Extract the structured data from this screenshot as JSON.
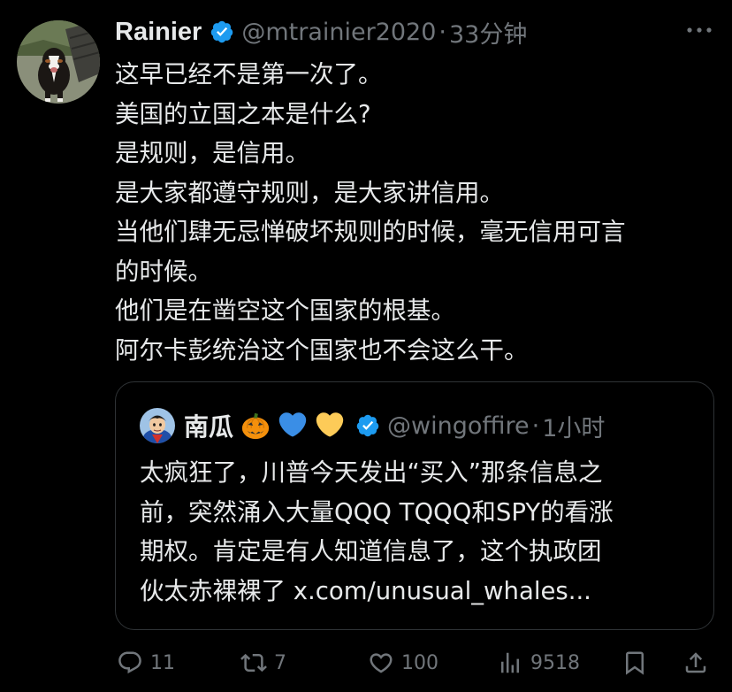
{
  "tweet": {
    "author": {
      "display_name": "Rainier",
      "handle": "@mtrainier2020",
      "separator": "·",
      "time": "33分钟"
    },
    "text_lines": [
      "这早已经不是第一次了。",
      "美国的立国之本是什么?",
      "是规则，是信用。",
      "是大家都遵守规则，是大家讲信用。",
      "当他们肆无忌惮破坏规则的时候，毫无信用可言",
      "的时候。",
      "他们是在凿空这个国家的根基。",
      "阿尔卡彭统治这个国家也不会这么干。"
    ]
  },
  "quote": {
    "author": {
      "display_name": "南瓜",
      "emojis": [
        "jack-o-lantern-icon",
        "blue-heart-icon",
        "yellow-heart-icon"
      ],
      "handle": "@wingoffire",
      "separator": "·",
      "time": "1小时"
    },
    "text_lines": [
      "太疯狂了，川普今天发出“买入”那条信息之",
      "前，突然涌入大量QQQ TQQQ和SPY的看涨",
      "期权。肯定是有人知道信息了，这个执政团",
      "伙太赤裸裸了 x.com/unusual_whales..."
    ]
  },
  "actions": {
    "replies": "11",
    "reposts": "7",
    "likes": "100",
    "views": "9518"
  },
  "colors": {
    "background": "#000000",
    "text": "#e7e9ea",
    "secondary": "#71767b",
    "verified": "#1d9bf0",
    "border": "#2f3336"
  }
}
